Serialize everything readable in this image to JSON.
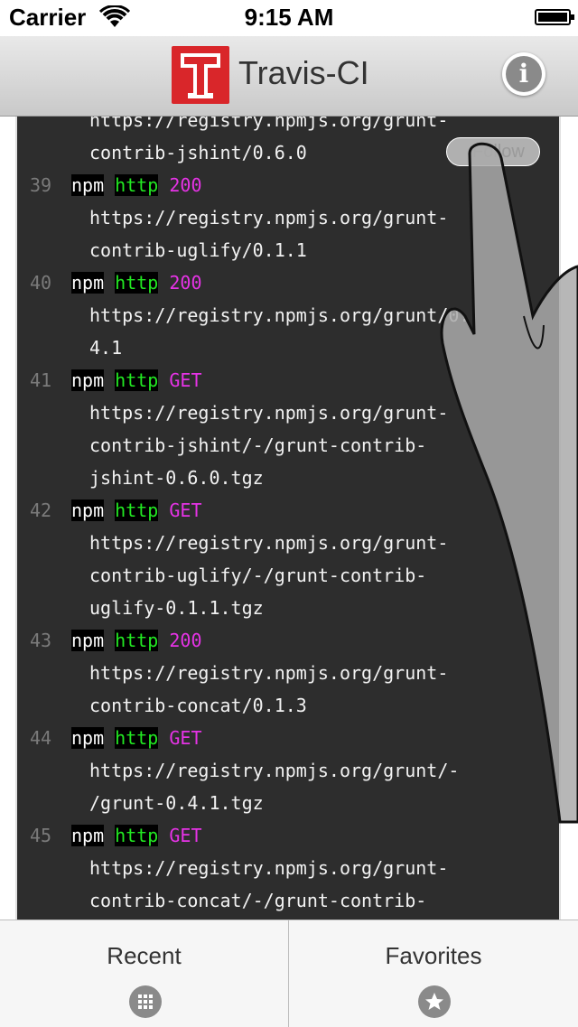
{
  "status_bar": {
    "carrier": "Carrier",
    "time": "9:15 AM"
  },
  "nav": {
    "title": "Travis-CI",
    "logo_letter": "T",
    "info_label": "i"
  },
  "follow_toggle": {
    "label": "Follow",
    "enabled": false
  },
  "log": {
    "top_partial_text": "https://registry.npmjs.org/grunt-",
    "top_partial_cont": "contrib-jshint/0.6.0",
    "lines": [
      {
        "num": "39",
        "cmd": "npm",
        "proto": "http",
        "code": "200",
        "cont": [
          "https://registry.npmjs.org/grunt-",
          "contrib-uglify/0.1.1"
        ]
      },
      {
        "num": "40",
        "cmd": "npm",
        "proto": "http",
        "code": "200",
        "cont": [
          "https://registry.npmjs.org/grunt/0.",
          "4.1"
        ]
      },
      {
        "num": "41",
        "cmd": "npm",
        "proto": "http",
        "code": "GET",
        "cont": [
          "https://registry.npmjs.org/grunt-",
          "contrib-jshint/-/grunt-contrib-",
          "jshint-0.6.0.tgz"
        ]
      },
      {
        "num": "42",
        "cmd": "npm",
        "proto": "http",
        "code": "GET",
        "cont": [
          "https://registry.npmjs.org/grunt-",
          "contrib-uglify/-/grunt-contrib-",
          "uglify-0.1.1.tgz"
        ]
      },
      {
        "num": "43",
        "cmd": "npm",
        "proto": "http",
        "code": "200",
        "cont": [
          "https://registry.npmjs.org/grunt-",
          "contrib-concat/0.1.3"
        ]
      },
      {
        "num": "44",
        "cmd": "npm",
        "proto": "http",
        "code": "GET",
        "cont": [
          "https://registry.npmjs.org/grunt/-",
          "/grunt-0.4.1.tgz"
        ]
      },
      {
        "num": "45",
        "cmd": "npm",
        "proto": "http",
        "code": "GET",
        "cont": [
          "https://registry.npmjs.org/grunt-",
          "contrib-concat/-/grunt-contrib-"
        ]
      }
    ]
  },
  "tabs": [
    {
      "label": "Recent",
      "icon": "grid-icon"
    },
    {
      "label": "Favorites",
      "icon": "star-icon"
    }
  ],
  "colors": {
    "log_bg": "#2d2d2d",
    "http_green": "#22e822",
    "code_magenta": "#e633e6",
    "logo_red": "#d9262a"
  }
}
